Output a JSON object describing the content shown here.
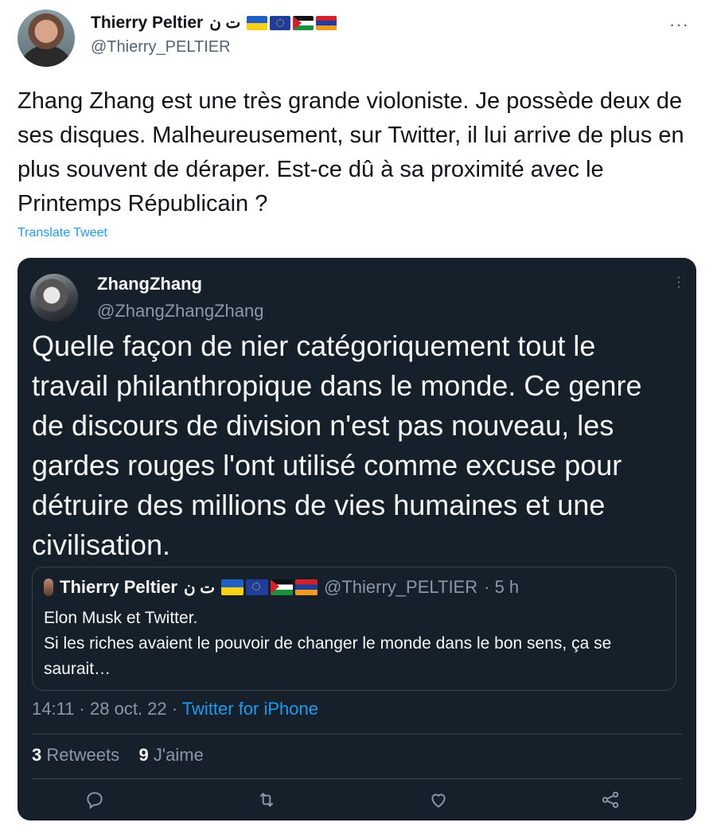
{
  "tweet": {
    "author_name": "Thierry Peltier",
    "author_arabic": "ت ن",
    "author_handle": "@Thierry_PELTIER",
    "more_label": "···",
    "text": "Zhang Zhang est une très grande violoniste. Je possède deux de ses disques. Malheureusement, sur Twitter, il lui arrive de plus en plus souvent de déraper. Est-ce dû à sa proximité avec le Printemps Républicain ?",
    "translate_label": "Translate Tweet"
  },
  "quoted": {
    "name": "ZhangZhang",
    "handle": "@ZhangZhangZhang",
    "text": "Quelle façon de nier catégoriquement tout le travail philanthropique dans le monde. Ce genre de discours de division n'est pas nouveau, les gardes rouges l'ont utilisé comme excuse pour détruire des millions de vies humaines et une civilisation.",
    "nested": {
      "name": "Thierry Peltier",
      "arabic": "ت ن",
      "handle": "@Thierry_PELTIER",
      "time": "· 5 h",
      "line1": "Elon Musk et Twitter.",
      "line2": "Si les riches avaient le pouvoir de changer le monde dans le bon sens, ça se saurait…"
    },
    "meta": {
      "time": "14:11",
      "sep1": "·",
      "date": "28 oct. 22",
      "sep2": "·",
      "source": "Twitter for iPhone"
    },
    "stats": {
      "retweets_count": "3",
      "retweets_label": "Retweets",
      "likes_count": "9",
      "likes_label": "J'aime"
    }
  },
  "colors": {
    "card_bg": "#15202b",
    "link": "#1d9bf0",
    "muted_dark": "#8b98a5",
    "muted_light": "#536471"
  },
  "icons": [
    "reply-icon",
    "retweet-icon",
    "like-icon",
    "share-icon"
  ]
}
